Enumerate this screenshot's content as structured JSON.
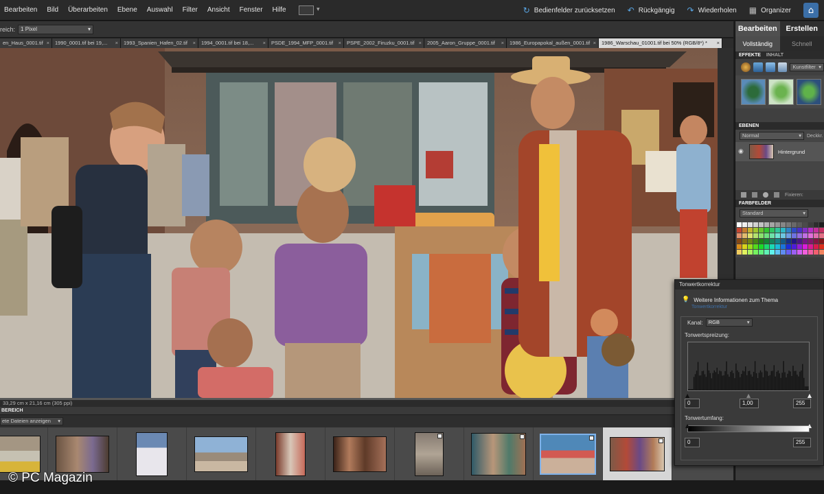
{
  "menu": {
    "items": [
      "Bearbeiten",
      "Bild",
      "Überarbeiten",
      "Ebene",
      "Auswahl",
      "Filter",
      "Ansicht",
      "Fenster",
      "Hilfe"
    ],
    "actions": [
      {
        "label": "Bedienfelder zurücksetzen",
        "icon": "reset-icon"
      },
      {
        "label": "Rückgängig",
        "icon": "undo-icon"
      },
      {
        "label": "Wiederholen",
        "icon": "redo-icon"
      },
      {
        "label": "Organizer",
        "icon": "organizer-icon"
      }
    ]
  },
  "options": {
    "label": "reich:",
    "value": "1 Pixel"
  },
  "tabs": [
    {
      "label": "en_Haus_0001.tif",
      "active": false
    },
    {
      "label": "1990_0001.tif bei 19,...",
      "active": false
    },
    {
      "label": "1993_Spanien_Hafen_02.tif",
      "active": false
    },
    {
      "label": "1994_0001.tif bei 18,...",
      "active": false
    },
    {
      "label": "PSDE_1994_MFP_0001.tif",
      "active": false
    },
    {
      "label": "PSPE_2002_Firuzku_0001.tif",
      "active": false
    },
    {
      "label": "2005_Aaron_Gruppe_0001.tif",
      "active": false
    },
    {
      "label": "1986_Europapokal_außen_0001.tif",
      "active": false
    },
    {
      "label": "1986_Warschau_01001.tif bei 50% (RGB/8*) *",
      "active": true
    }
  ],
  "status": "33,29 cm x 21,16 cm (305 ppi)",
  "bin": {
    "title": "BEREICH",
    "filter": "ete Dateien anzeigen"
  },
  "panel": {
    "tabs": [
      "Bearbeiten",
      "Erstellen"
    ],
    "modes": [
      "Vollständig",
      "Schnell"
    ],
    "effects_head": [
      "EFFEKTE",
      "INHALT"
    ],
    "effects_dd": "Kunstfilter",
    "layers_head": "EBENEN",
    "blend": "Normal",
    "opacity_label": "Deckkr.",
    "layer_name": "Hintergrund",
    "lock_label": "Fixieren:",
    "swatch_head": "FARBFELDER",
    "swatch_set": "Standard"
  },
  "levels": {
    "title": "Tonwertkorrektur",
    "info": "Weitere Informationen zum Thema",
    "info_link": "Tonwertkorrektur",
    "channel_label": "Kanal:",
    "channel": "RGB",
    "input_label": "Tonwertspreizung:",
    "input_black": "0",
    "input_gamma": "1,00",
    "input_white": "255",
    "output_label": "Tonwertumfang:",
    "output_black": "0",
    "output_white": "255"
  },
  "watermark": "© PC Magazin"
}
